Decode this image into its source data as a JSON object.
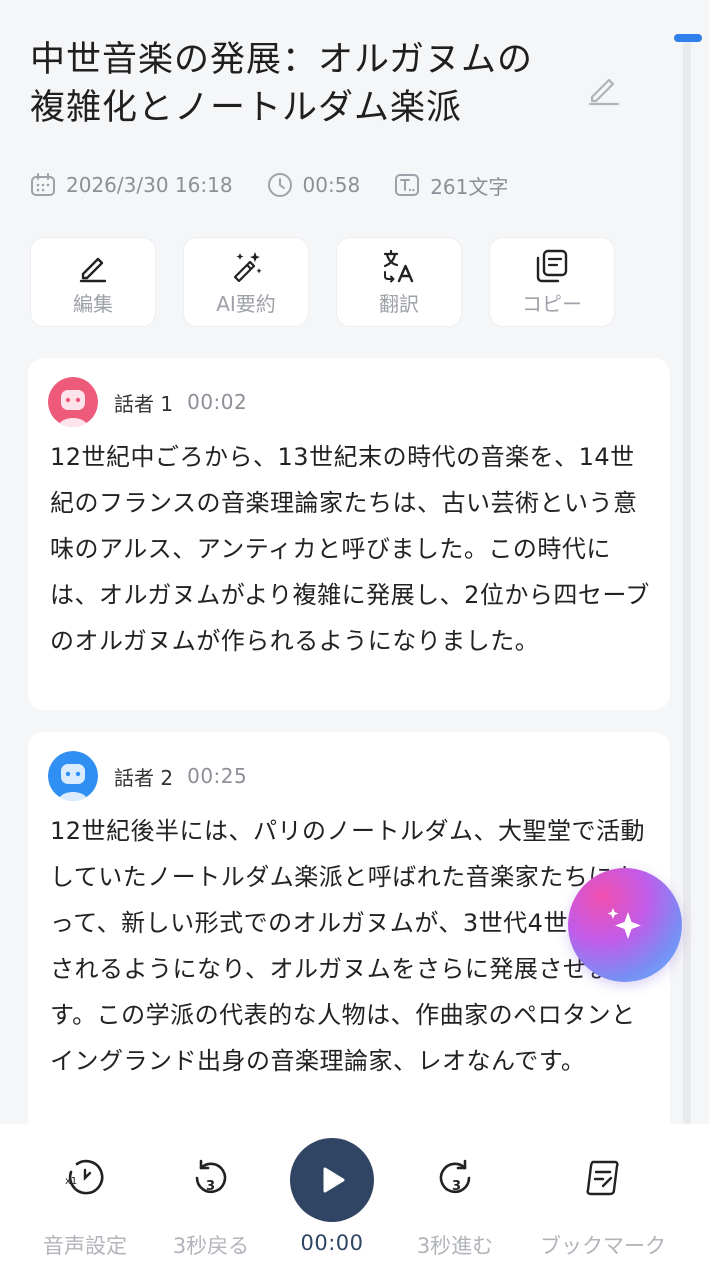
{
  "header": {
    "title_line1": "中世音楽の発展：オルガヌムの",
    "title_line2": "複雑化とノートルダム楽派",
    "date": "2026/3/30  16:18",
    "duration": "00:58",
    "char_count": "261文字"
  },
  "actions": [
    {
      "label": "編集",
      "icon": "pencil-icon"
    },
    {
      "label": "AI要約",
      "icon": "magic-wand-icon"
    },
    {
      "label": "翻訳",
      "icon": "translate-icon"
    },
    {
      "label": "コピー",
      "icon": "copy-icon"
    }
  ],
  "transcript": [
    {
      "speaker": "話者 1",
      "time": "00:02",
      "avatar_color": "#ee5a7a",
      "text": "12世紀中ごろから、13世紀末の時代の音楽を、14世紀のフランスの音楽理論家たちは、古い芸術という意味のアルス、アンティカと呼びました。この時代には、オルガヌムがより複雑に発展し、2位から四セーブのオルガヌムが作られるようになりました。"
    },
    {
      "speaker": "話者 2",
      "time": "00:25",
      "avatar_color": "#2f8ff2",
      "text": "12世紀後半には、パリのノートルダム、大聖堂で活動していたノートルダム楽派と呼ばれた音楽家たちによって、新しい形式でのオルガヌムが、3世代4世で作曲されるようになり、オルガヌムをさらに発展させます。この学派の代表的な人物は、作曲家のペロタンとイングランド出身の音楽理論家、レオなんです。"
    }
  ],
  "player": {
    "audio_settings_label": "音声設定",
    "back_label": "3秒戻る",
    "play_time": "00:00",
    "forward_label": "3秒進む",
    "bookmark_label": "ブックマーク",
    "speed_badge": "x1",
    "skip_seconds": "3"
  },
  "colors": {
    "accent": "#2f80ed",
    "play_button": "#2f4563"
  }
}
